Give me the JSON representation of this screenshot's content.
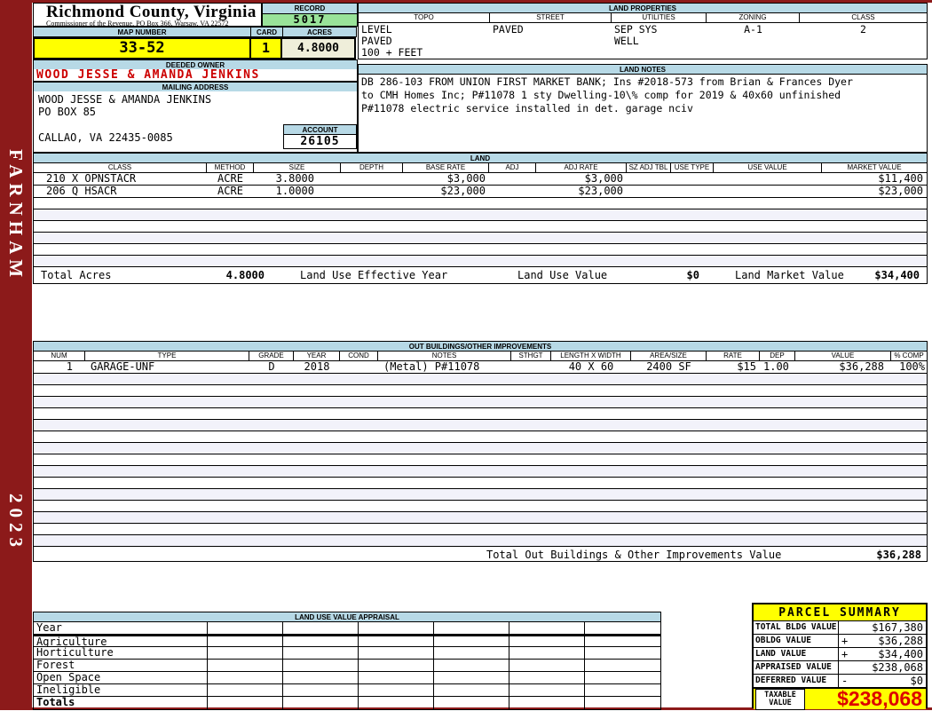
{
  "colors": {
    "frame_red": "#8c1a1a",
    "band_blue": "#b7d9e6",
    "hl_yellow": "#ffff00",
    "rec_green": "#99e399",
    "cream": "#efeeda",
    "stripe": "#f2f2fa",
    "owner_red": "#cc0000",
    "big_red": "#dd0000"
  },
  "sidebar": {
    "district": "FARNHAM",
    "year": "2023"
  },
  "header": {
    "county": "Richmond County, Virginia",
    "commissioner": "Commissioner of the Revenue, PO Box 366, Warsaw, VA 22572"
  },
  "record": {
    "label": "RECORD",
    "value": "5017"
  },
  "map": {
    "map_number_label": "MAP NUMBER",
    "map_number": "33-52",
    "card_label": "CARD",
    "card": "1",
    "acres_label": "ACRES",
    "acres": "4.8000"
  },
  "land_properties": {
    "title": "LAND PROPERTIES",
    "columns": [
      "TOPO",
      "STREET",
      "UTILITIES",
      "ZONING",
      "CLASS"
    ],
    "topo": "LEVEL\nPAVED\n100 + FEET",
    "street": "PAVED",
    "utilities": "SEP SYS\nWELL",
    "zoning": "A-1",
    "class": "2"
  },
  "owner": {
    "deeded_owner_label": "DEEDED OWNER",
    "name": "WOOD JESSE & AMANDA JENKINS",
    "mailing_label": "MAILING ADDRESS",
    "mailing_line1": "WOOD JESSE & AMANDA JENKINS",
    "mailing_line2": "PO BOX 85",
    "mailing_line3": "CALLAO, VA 22435-0085",
    "account_label": "ACCOUNT",
    "account": "26105"
  },
  "land_notes": {
    "title": "LAND NOTES",
    "line1": "DB 286-103 FROM UNION FIRST MARKET BANK; Ins #2018-573 from Brian & Frances Dyer",
    "line2": "to CMH Homes Inc; P#11078 1 sty Dwelling-10\\% comp for 2019 & 40x60 unfinished",
    "line3": "P#11078 electric service installed in det. garage nciv"
  },
  "land": {
    "title": "LAND",
    "columns": [
      "CLASS",
      "METHOD",
      "SIZE",
      "DEPTH",
      "BASE RATE",
      "ADJ",
      "ADJ RATE",
      "SZ ADJ TBL",
      "USE TYPE",
      "USE VALUE",
      "MARKET VALUE"
    ],
    "rows": [
      {
        "class": "210 X OPNSTACR",
        "method": "ACRE",
        "size": "3.8000",
        "depth": "",
        "base_rate": "$3,000",
        "adj": "",
        "adj_rate": "$3,000",
        "sz_adj_tbl": "",
        "use_type": "",
        "use_value": "",
        "market_value": "$11,400"
      },
      {
        "class": "206 Q HSACR",
        "method": "ACRE",
        "size": "1.0000",
        "depth": "",
        "base_rate": "$23,000",
        "adj": "",
        "adj_rate": "$23,000",
        "sz_adj_tbl": "",
        "use_type": "",
        "use_value": "",
        "market_value": "$23,000"
      }
    ],
    "totals": {
      "total_acres_label": "Total Acres",
      "total_acres": "4.8000",
      "effective_year_label": "Land Use Effective Year",
      "use_value_label": "Land Use Value",
      "use_value": "$0",
      "market_value_label": "Land Market Value",
      "market_value": "$34,400"
    }
  },
  "out_buildings": {
    "title": "OUT BUILDINGS/OTHER IMPROVEMENTS",
    "columns": [
      "NUM",
      "TYPE",
      "GRADE",
      "YEAR",
      "COND",
      "NOTES",
      "STHGT",
      "LENGTH X WIDTH",
      "AREA/SIZE",
      "RATE",
      "DEP",
      "VALUE",
      "% COMP"
    ],
    "rows": [
      {
        "num": "1",
        "type": "GARAGE-UNF",
        "grade": "D",
        "year": "2018",
        "cond": "",
        "notes": "(Metal) P#11078",
        "sthgt": "",
        "length_width": "40 X 60",
        "area_size": "2400 SF",
        "rate": "$15",
        "dep": "1.00",
        "value": "$36,288",
        "pct_comp": "100%"
      }
    ],
    "total_label": "Total Out Buildings & Other Improvements Value",
    "total_value": "$36,288"
  },
  "land_use_appraisal": {
    "title": "LAND USE VALUE APPRAISAL",
    "row_labels": [
      "Year",
      "Agriculture",
      "Horticulture",
      "Forest",
      "Open Space",
      "Ineligible",
      "Totals"
    ]
  },
  "parcel_summary": {
    "title": "PARCEL SUMMARY",
    "rows": [
      {
        "label": "TOTAL BLDG VALUE",
        "op": "",
        "value": "$167,380"
      },
      {
        "label": "OBLDG VALUE",
        "op": "+",
        "value": "$36,288"
      },
      {
        "label": "LAND VALUE",
        "op": "+",
        "value": "$34,400"
      },
      {
        "label": "APPRAISED VALUE",
        "op": "",
        "value": "$238,068"
      },
      {
        "label": "DEFERRED VALUE",
        "op": "-",
        "value": "$0"
      }
    ],
    "taxable_label": "TAXABLE VALUE",
    "taxable_value": "$238,068"
  }
}
